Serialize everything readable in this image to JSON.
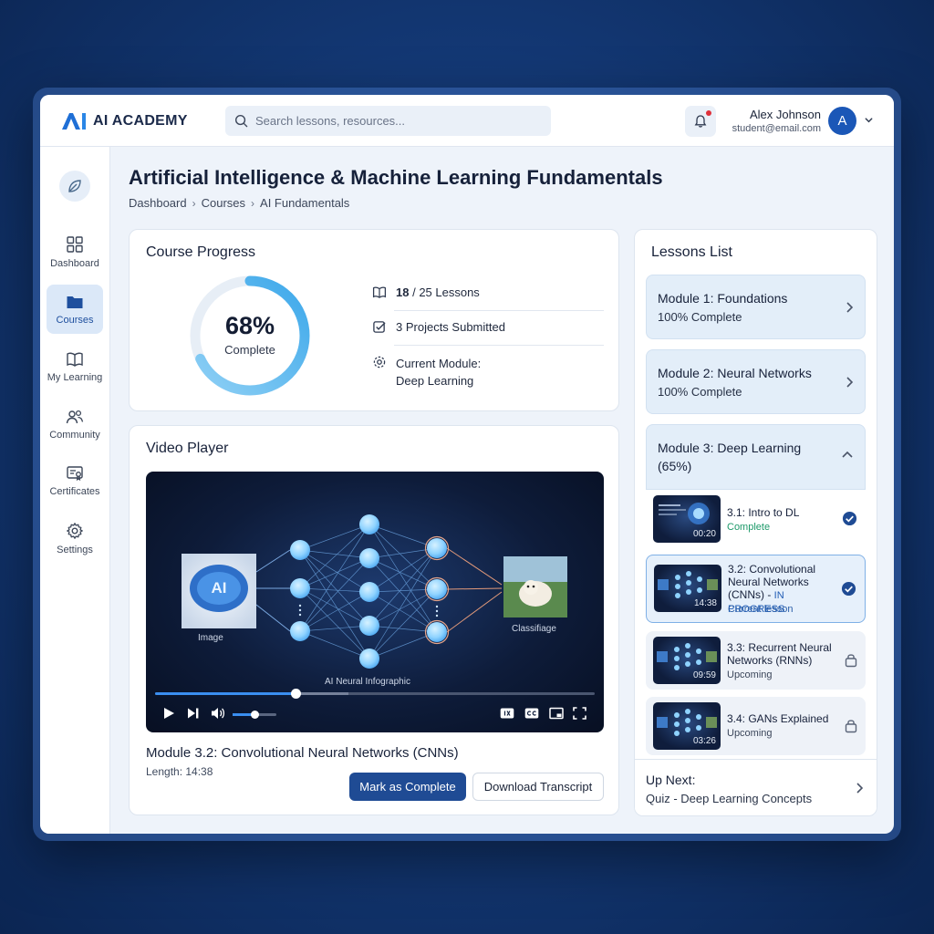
{
  "app": {
    "name": "AI ACADEMY"
  },
  "search": {
    "placeholder": "Search lessons, resources..."
  },
  "user": {
    "name": "Alex Johnson",
    "email": "student@email.com",
    "initial": "A"
  },
  "sidebar": {
    "items": [
      {
        "label": "Dashboard",
        "icon": "grid-icon"
      },
      {
        "label": "Courses",
        "icon": "folder-icon",
        "active": true
      },
      {
        "label": "My Learning",
        "icon": "book-icon"
      },
      {
        "label": "Community",
        "icon": "users-icon"
      },
      {
        "label": "Certificates",
        "icon": "certificate-icon"
      },
      {
        "label": "Settings",
        "icon": "gear-icon"
      }
    ]
  },
  "page": {
    "title": "Artificial Intelligence & Machine Learning Fundamentals",
    "breadcrumb": [
      "Dashboard",
      "Courses",
      "AI Fundamentals"
    ]
  },
  "progress": {
    "title": "Course Progress",
    "percent_label": "68%",
    "percent_value": 68,
    "complete_label": "Complete",
    "lessons_done": "18",
    "lessons_rest": "/ 25 Lessons",
    "projects": "3 Projects Submitted",
    "current_module_label": "Current Module:",
    "current_module": "Deep Learning"
  },
  "video": {
    "title": "Video Player",
    "input_label": "Image",
    "output_label": "Classifiage",
    "graphic_caption": "AI Neural Infographic",
    "played_fraction": 0.32,
    "buffered_fraction": 0.44,
    "volume_fraction": 0.5,
    "lesson_title": "Module 3.2: Convolutional Neural Networks (CNNs)",
    "length": "Length: 14:38",
    "mark_complete": "Mark as Complete",
    "download_transcript": "Download Transcript"
  },
  "lessons": {
    "title": "Lessons List",
    "modules": [
      {
        "name": "Module 1: Foundations",
        "sub": "100% Complete"
      },
      {
        "name": "Module 2: Neural Networks",
        "sub": "100% Complete"
      },
      {
        "name": "Module 3: Deep Learning",
        "sub": "(65%)"
      }
    ],
    "items": [
      {
        "name": "3.1: Intro to DL",
        "status": "Complete",
        "time": "00:20"
      },
      {
        "name": "3.2: Convolutional Neural Networks (CNNs) - ",
        "tag": "IN PROGRESS",
        "status": "Current lesson",
        "time": "14:38"
      },
      {
        "name": "3.3: Recurrent Neural Networks (RNNs)",
        "status": "Upcoming",
        "time": "09:59"
      },
      {
        "name": "3.4: GANs Explained",
        "status": "Upcoming",
        "time": "03:26"
      }
    ],
    "up_next_label": "Up Next:",
    "up_next_value": "Quiz - Deep Learning Concepts"
  },
  "colors": {
    "accent": "#1f4b94",
    "ring": "#4db0ee",
    "success": "#1e9a6a"
  }
}
